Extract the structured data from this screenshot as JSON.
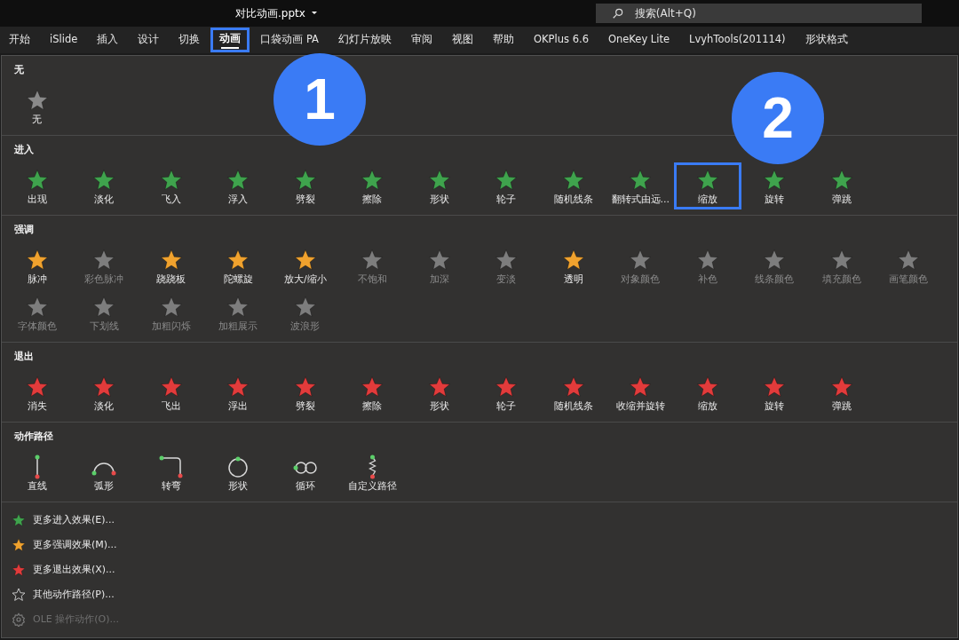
{
  "title_bar": {
    "file_name": "对比动画.pptx",
    "search": {
      "placeholder": "搜索(Alt+Q)"
    }
  },
  "ribbon_tabs": [
    {
      "label": "开始",
      "selected": false,
      "highlighted": false
    },
    {
      "label": "iSlide",
      "selected": false,
      "highlighted": false
    },
    {
      "label": "插入",
      "selected": false,
      "highlighted": false
    },
    {
      "label": "设计",
      "selected": false,
      "highlighted": false
    },
    {
      "label": "切换",
      "selected": false,
      "highlighted": false
    },
    {
      "label": "动画",
      "selected": true,
      "highlighted": true
    },
    {
      "label": "口袋动画 PA",
      "selected": false,
      "highlighted": false
    },
    {
      "label": "幻灯片放映",
      "selected": false,
      "highlighted": false
    },
    {
      "label": "审阅",
      "selected": false,
      "highlighted": false
    },
    {
      "label": "视图",
      "selected": false,
      "highlighted": false
    },
    {
      "label": "帮助",
      "selected": false,
      "highlighted": false
    },
    {
      "label": "OKPlus 6.6",
      "selected": false,
      "highlighted": false
    },
    {
      "label": "OneKey Lite",
      "selected": false,
      "highlighted": false
    },
    {
      "label": "LvyhTools(201114)",
      "selected": false,
      "highlighted": false
    },
    {
      "label": "形状格式",
      "selected": false,
      "highlighted": false
    }
  ],
  "sections": [
    {
      "title": "无",
      "kind": "none",
      "items": [
        {
          "label": "无",
          "disabled": false,
          "highlighted": false
        }
      ]
    },
    {
      "title": "进入",
      "kind": "entrance",
      "items": [
        {
          "label": "出现",
          "disabled": false,
          "highlighted": false
        },
        {
          "label": "淡化",
          "disabled": false,
          "highlighted": false
        },
        {
          "label": "飞入",
          "disabled": false,
          "highlighted": false
        },
        {
          "label": "浮入",
          "disabled": false,
          "highlighted": false
        },
        {
          "label": "劈裂",
          "disabled": false,
          "highlighted": false
        },
        {
          "label": "擦除",
          "disabled": false,
          "highlighted": false
        },
        {
          "label": "形状",
          "disabled": false,
          "highlighted": false
        },
        {
          "label": "轮子",
          "disabled": false,
          "highlighted": false
        },
        {
          "label": "随机线条",
          "disabled": false,
          "highlighted": false
        },
        {
          "label": "翻转式由远...",
          "disabled": false,
          "highlighted": false
        },
        {
          "label": "缩放",
          "disabled": false,
          "highlighted": true
        },
        {
          "label": "旋转",
          "disabled": false,
          "highlighted": false
        },
        {
          "label": "弹跳",
          "disabled": false,
          "highlighted": false
        }
      ]
    },
    {
      "title": "强调",
      "kind": "emphasis",
      "items": [
        {
          "label": "脉冲",
          "disabled": false,
          "highlighted": false
        },
        {
          "label": "彩色脉冲",
          "disabled": true,
          "highlighted": false
        },
        {
          "label": "跷跷板",
          "disabled": false,
          "highlighted": false
        },
        {
          "label": "陀螺旋",
          "disabled": false,
          "highlighted": false
        },
        {
          "label": "放大/缩小",
          "disabled": false,
          "highlighted": false
        },
        {
          "label": "不饱和",
          "disabled": true,
          "highlighted": false
        },
        {
          "label": "加深",
          "disabled": true,
          "highlighted": false
        },
        {
          "label": "变淡",
          "disabled": true,
          "highlighted": false
        },
        {
          "label": "透明",
          "disabled": false,
          "highlighted": false
        },
        {
          "label": "对象颜色",
          "disabled": true,
          "highlighted": false
        },
        {
          "label": "补色",
          "disabled": true,
          "highlighted": false
        },
        {
          "label": "线条颜色",
          "disabled": true,
          "highlighted": false
        },
        {
          "label": "填充颜色",
          "disabled": true,
          "highlighted": false
        },
        {
          "label": "画笔颜色",
          "disabled": true,
          "highlighted": false
        },
        {
          "label": "字体颜色",
          "disabled": true,
          "highlighted": false
        },
        {
          "label": "下划线",
          "disabled": true,
          "highlighted": false
        },
        {
          "label": "加粗闪烁",
          "disabled": true,
          "highlighted": false
        },
        {
          "label": "加粗展示",
          "disabled": true,
          "highlighted": false
        },
        {
          "label": "波浪形",
          "disabled": true,
          "highlighted": false
        }
      ]
    },
    {
      "title": "退出",
      "kind": "exit",
      "items": [
        {
          "label": "消失",
          "disabled": false,
          "highlighted": false
        },
        {
          "label": "淡化",
          "disabled": false,
          "highlighted": false
        },
        {
          "label": "飞出",
          "disabled": false,
          "highlighted": false
        },
        {
          "label": "浮出",
          "disabled": false,
          "highlighted": false
        },
        {
          "label": "劈裂",
          "disabled": false,
          "highlighted": false
        },
        {
          "label": "擦除",
          "disabled": false,
          "highlighted": false
        },
        {
          "label": "形状",
          "disabled": false,
          "highlighted": false
        },
        {
          "label": "轮子",
          "disabled": false,
          "highlighted": false
        },
        {
          "label": "随机线条",
          "disabled": false,
          "highlighted": false
        },
        {
          "label": "收缩并旋转",
          "disabled": false,
          "highlighted": false
        },
        {
          "label": "缩放",
          "disabled": false,
          "highlighted": false
        },
        {
          "label": "旋转",
          "disabled": false,
          "highlighted": false
        },
        {
          "label": "弹跳",
          "disabled": false,
          "highlighted": false
        }
      ]
    },
    {
      "title": "动作路径",
      "kind": "path",
      "items": [
        {
          "label": "直线",
          "disabled": false,
          "highlighted": false
        },
        {
          "label": "弧形",
          "disabled": false,
          "highlighted": false
        },
        {
          "label": "转弯",
          "disabled": false,
          "highlighted": false
        },
        {
          "label": "形状",
          "disabled": false,
          "highlighted": false
        },
        {
          "label": "循环",
          "disabled": false,
          "highlighted": false
        },
        {
          "label": "自定义路径",
          "disabled": false,
          "highlighted": false
        }
      ]
    }
  ],
  "more_options": [
    {
      "kind": "entrance",
      "label": "更多进入效果(E)...",
      "disabled": false
    },
    {
      "kind": "emphasis",
      "label": "更多强调效果(M)...",
      "disabled": false
    },
    {
      "kind": "exit",
      "label": "更多退出效果(X)...",
      "disabled": false
    },
    {
      "kind": "path",
      "label": "其他动作路径(P)...",
      "disabled": false
    },
    {
      "kind": "ole",
      "label": "OLE 操作动作(O)...",
      "disabled": true
    }
  ],
  "annotations": [
    {
      "label": "1"
    },
    {
      "label": "2"
    }
  ]
}
